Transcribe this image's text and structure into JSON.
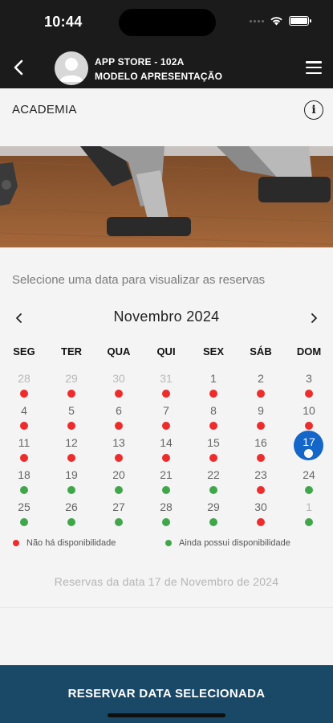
{
  "status_bar": {
    "time": "10:44"
  },
  "header": {
    "store_name": "APP STORE - 102A",
    "store_subtitle": "MODELO APRESENTAÇÃO"
  },
  "section": {
    "title": "ACADEMIA"
  },
  "calendar": {
    "instruction": "Selecione uma data para visualizar as reservas",
    "month_label": "Novembro 2024",
    "weekdays": [
      "SEG",
      "TER",
      "QUA",
      "QUI",
      "SEX",
      "SÁB",
      "DOM"
    ],
    "weeks": [
      [
        {
          "day": "28",
          "other": true,
          "status": "red"
        },
        {
          "day": "29",
          "other": true,
          "status": "red"
        },
        {
          "day": "30",
          "other": true,
          "status": "red"
        },
        {
          "day": "31",
          "other": true,
          "status": "red"
        },
        {
          "day": "1",
          "other": false,
          "status": "red"
        },
        {
          "day": "2",
          "other": false,
          "status": "red"
        },
        {
          "day": "3",
          "other": false,
          "status": "red"
        }
      ],
      [
        {
          "day": "4",
          "other": false,
          "status": "red"
        },
        {
          "day": "5",
          "other": false,
          "status": "red"
        },
        {
          "day": "6",
          "other": false,
          "status": "red"
        },
        {
          "day": "7",
          "other": false,
          "status": "red"
        },
        {
          "day": "8",
          "other": false,
          "status": "red"
        },
        {
          "day": "9",
          "other": false,
          "status": "red"
        },
        {
          "day": "10",
          "other": false,
          "status": "red"
        }
      ],
      [
        {
          "day": "11",
          "other": false,
          "status": "red"
        },
        {
          "day": "12",
          "other": false,
          "status": "red"
        },
        {
          "day": "13",
          "other": false,
          "status": "red"
        },
        {
          "day": "14",
          "other": false,
          "status": "red"
        },
        {
          "day": "15",
          "other": false,
          "status": "red"
        },
        {
          "day": "16",
          "other": false,
          "status": "red"
        },
        {
          "day": "17",
          "other": false,
          "status": "selected"
        }
      ],
      [
        {
          "day": "18",
          "other": false,
          "status": "green"
        },
        {
          "day": "19",
          "other": false,
          "status": "green"
        },
        {
          "day": "20",
          "other": false,
          "status": "green"
        },
        {
          "day": "21",
          "other": false,
          "status": "green"
        },
        {
          "day": "22",
          "other": false,
          "status": "green"
        },
        {
          "day": "23",
          "other": false,
          "status": "red"
        },
        {
          "day": "24",
          "other": false,
          "status": "green"
        }
      ],
      [
        {
          "day": "25",
          "other": false,
          "status": "green"
        },
        {
          "day": "26",
          "other": false,
          "status": "green"
        },
        {
          "day": "27",
          "other": false,
          "status": "green"
        },
        {
          "day": "28",
          "other": false,
          "status": "green"
        },
        {
          "day": "29",
          "other": false,
          "status": "green"
        },
        {
          "day": "30",
          "other": false,
          "status": "red"
        },
        {
          "day": "1",
          "other": true,
          "status": "green"
        }
      ]
    ],
    "selected_day": "17"
  },
  "legend": {
    "unavailable": "Não há disponibilidade",
    "available": "Ainda possui disponibilidade"
  },
  "reservations": {
    "label": "Reservas da data  17 de Novembro de 2024"
  },
  "footer": {
    "reserve_button": "RESERVAR DATA SELECIONADA"
  },
  "colors": {
    "header_bg": "#1b1b1b",
    "footer_bg": "#1a4968",
    "selected": "#1466c8",
    "unavailable": "#ef2b2b",
    "available": "#3fa74a"
  },
  "icons": {
    "back": "chevron-left-icon",
    "menu": "hamburger-menu-icon",
    "info": "info-icon",
    "avatar": "user-avatar-icon",
    "prev_month": "chevron-left-icon",
    "next_month": "chevron-right-icon"
  }
}
